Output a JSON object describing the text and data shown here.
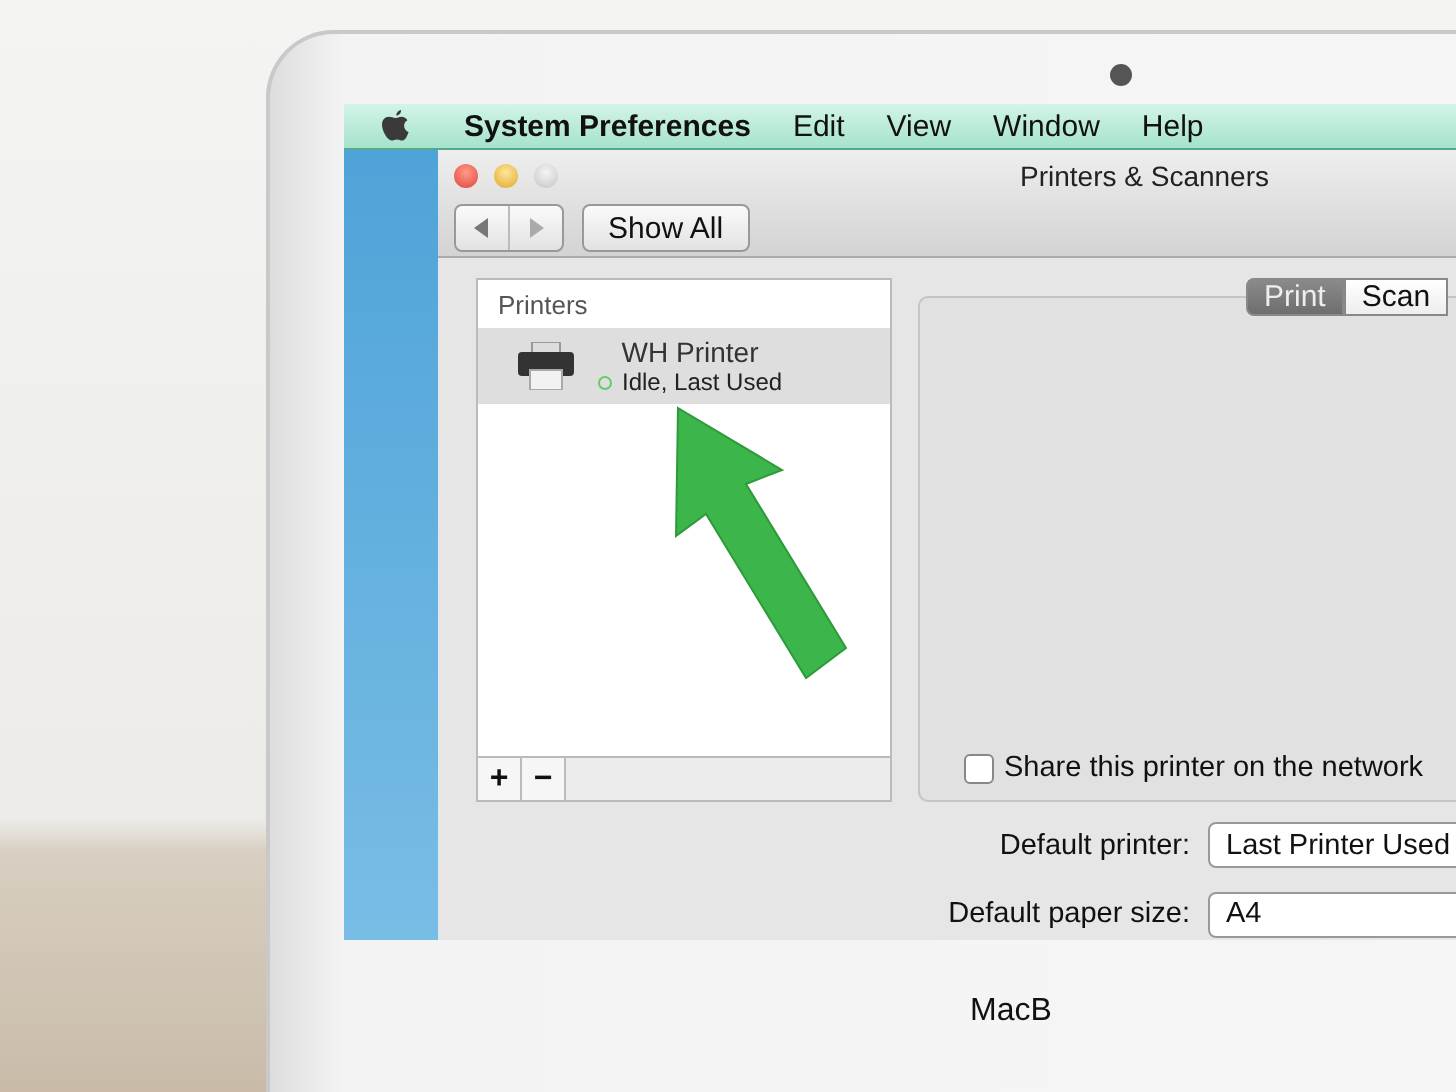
{
  "menubar": {
    "items": [
      {
        "label": "System Preferences",
        "kind": "app"
      },
      {
        "label": "Edit",
        "kind": "menu"
      },
      {
        "label": "View",
        "kind": "menu"
      },
      {
        "label": "Window",
        "kind": "menu"
      },
      {
        "label": "Help",
        "kind": "menu"
      }
    ]
  },
  "window": {
    "title": "Printers & Scanners",
    "show_all": "Show All"
  },
  "printers": {
    "header": "Printers",
    "items": [
      {
        "name": "WH Printer",
        "status": "Idle, Last Used",
        "selected": true
      }
    ],
    "add": "+",
    "remove": "−"
  },
  "tabs": [
    {
      "label": "Print",
      "selected": true
    },
    {
      "label": "Scan",
      "selected": false
    }
  ],
  "share": {
    "label": "Share this printer on the network",
    "checked": false
  },
  "settings": [
    {
      "label": "Default printer:",
      "value": "Last Printer Used"
    },
    {
      "label": "Default paper size:",
      "value": "A4"
    }
  ],
  "bezel_label": "MacB"
}
